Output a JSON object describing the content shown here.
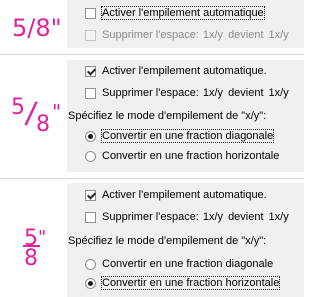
{
  "annotations": {
    "a": {
      "text": "5/8\""
    },
    "b": {
      "num": "5",
      "slash": "/",
      "den": "8",
      "mark": "\""
    },
    "c": {
      "num": "5",
      "den": "8",
      "mark": "\""
    }
  },
  "colors": {
    "annotation": "#e0229c",
    "panel": "#f0f0f0",
    "disabled_text": "#8a8a8a"
  },
  "panel1": {
    "enable_stacking": {
      "label": "Activer l'empilement automatique",
      "checked": false
    },
    "remove_space": {
      "label": "Supprimer l'espace:",
      "from": "1x/y",
      "becomes": "devient",
      "to": "1x/y",
      "checked": false,
      "disabled": true
    }
  },
  "panel2": {
    "enable_stacking": {
      "label": "Activer l'empilement automatique.",
      "checked": true
    },
    "remove_space": {
      "label": "Supprimer l'espace:",
      "from": "1x/y",
      "becomes": "devient",
      "to": "1x/y",
      "checked": false
    },
    "mode_label": "Spécifiez le mode d'empilement de \"x/y\":",
    "diagonal": {
      "label": "Convertir en une fraction diagonale",
      "selected": true
    },
    "horizontal": {
      "label": "Convertir en une fraction horizontale",
      "selected": false
    }
  },
  "panel3": {
    "enable_stacking": {
      "label": "Activer l'empilement automatique.",
      "checked": true
    },
    "remove_space": {
      "label": "Supprimer l'espace:",
      "from": "1x/y",
      "becomes": "devient",
      "to": "1x/y",
      "checked": false
    },
    "mode_label": "Spécifiez le mode d'empilement de \"x/y\":",
    "diagonal": {
      "label": "Convertir en une fraction diagonale",
      "selected": false
    },
    "horizontal": {
      "label": "Convertir en une fraction horizontale",
      "selected": true
    }
  }
}
